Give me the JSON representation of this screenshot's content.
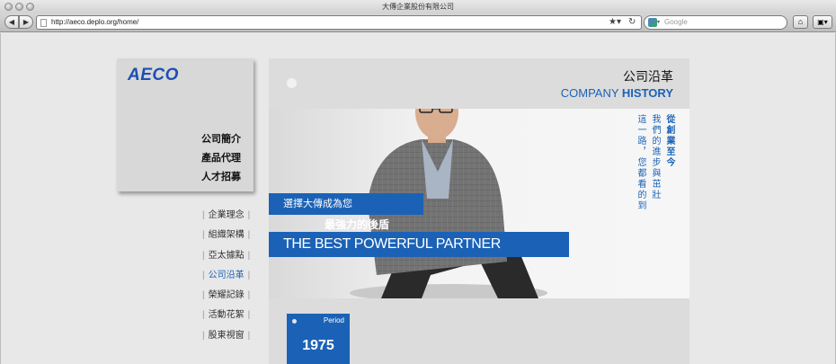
{
  "window": {
    "title": "大傳企業股份有限公司"
  },
  "toolbar": {
    "url": "http://aeco.deplo.org/home/",
    "search_placeholder": "Google"
  },
  "logo": "AECO",
  "main_nav": [
    "公司簡介",
    "產品代理",
    "人才招募"
  ],
  "sub_nav": [
    {
      "label": "企業理念",
      "active": false
    },
    {
      "label": "組織架構",
      "active": false
    },
    {
      "label": "亞太據點",
      "active": false
    },
    {
      "label": "公司沿革",
      "active": true
    },
    {
      "label": "榮耀記錄",
      "active": false
    },
    {
      "label": "活動花絮",
      "active": false
    },
    {
      "label": "股東視窗",
      "active": false
    }
  ],
  "section": {
    "title_cn": "公司沿革",
    "title_en_1": "COMPANY",
    "title_en_2": "HISTORY"
  },
  "vertical_text": {
    "col1": "從創業至今",
    "col2": "我們的進步與茁壯",
    "col3": "這一路，您都看的到"
  },
  "slogan": {
    "line1": "選擇大傳成為您",
    "line2": "最強力的後盾",
    "line3": "THE BEST POWERFUL PARTNER"
  },
  "period": {
    "label": "Period",
    "year": "1975"
  },
  "colors": {
    "accent": "#1b62b7"
  }
}
